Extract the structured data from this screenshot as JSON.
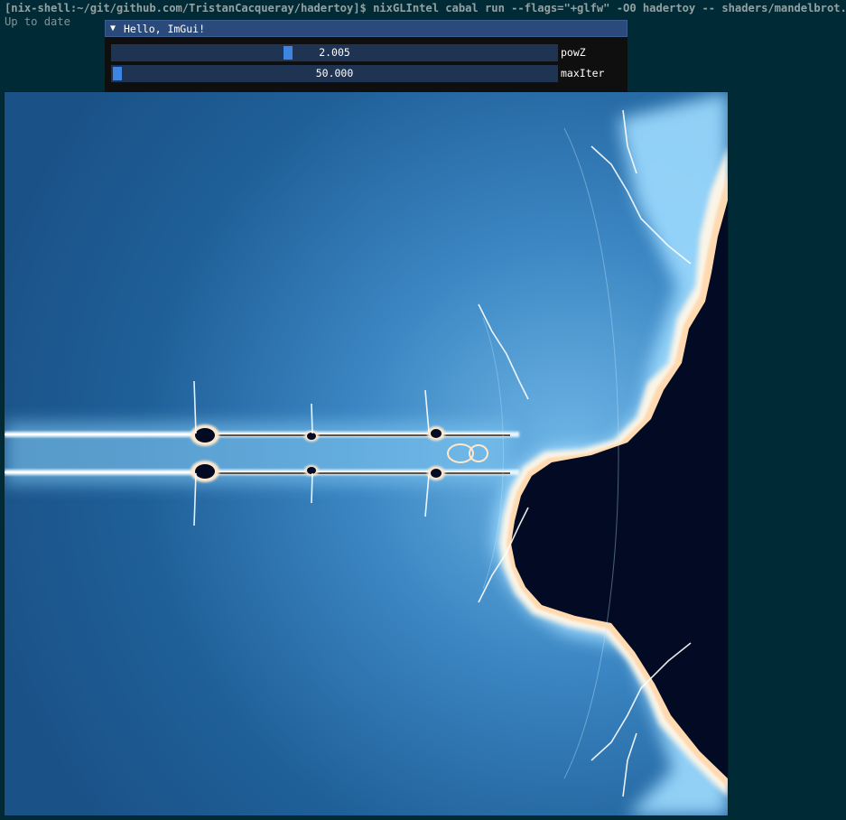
{
  "terminal": {
    "command_line": "[nix-shell:~/git/github.com/TristanCacqueray/hadertoy]$ nixGLIntel cabal run --flags=\"+glfw\" -O0 hadertoy -- shaders/mandelbrot.glsl",
    "output_line": "Up to date"
  },
  "imgui": {
    "collapse_glyph": "▼",
    "title": "Hello, ImGui!",
    "sliders": [
      {
        "label": "powZ",
        "display": "2.005",
        "fraction": 0.392
      },
      {
        "label": "maxIter",
        "display": "50.000",
        "fraction": 0.0
      }
    ]
  },
  "colors": {
    "terminal_bg": "#002b36",
    "imgui_title_bg": "#294a7a",
    "imgui_window_bg": "#0f0f0f",
    "slider_frame": "#1f3353",
    "slider_grab": "#3d85e0",
    "fractal_interior": "#020a24",
    "fractal_glow": "#ffe8c8",
    "fractal_background": "#1c5a8e"
  }
}
